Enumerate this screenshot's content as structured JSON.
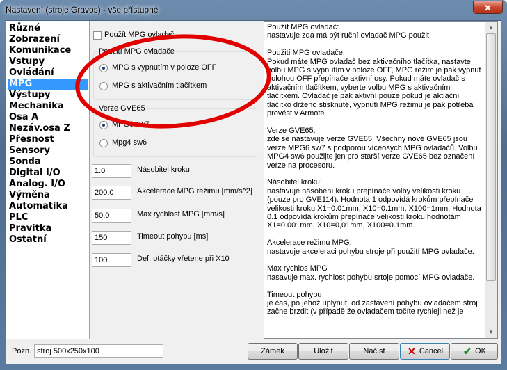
{
  "window": {
    "title": "Nastavení (stroje Gravos) - vše přístupné",
    "close_glyph": "✕"
  },
  "categories": [
    {
      "label": "Různé"
    },
    {
      "label": "Zobrazení"
    },
    {
      "label": "Komunikace"
    },
    {
      "label": "Vstupy"
    },
    {
      "label": "Ovládání"
    },
    {
      "label": "MPG",
      "selected": true
    },
    {
      "label": "Výstupy"
    },
    {
      "label": "Mechanika"
    },
    {
      "label": "Osa A"
    },
    {
      "label": "Nezáv.osa Z"
    },
    {
      "label": "Přesnost"
    },
    {
      "label": "Sensory"
    },
    {
      "label": "Sonda"
    },
    {
      "label": "Digital I/O"
    },
    {
      "label": "Analog. I/O"
    },
    {
      "label": "Výměna"
    },
    {
      "label": "Automatika"
    },
    {
      "label": "PLC"
    },
    {
      "label": "Pravitka"
    },
    {
      "label": "Ostatní"
    }
  ],
  "mpg": {
    "use_checkbox_label": "Použít MPG ovladač",
    "use_checked": false,
    "group_controller": {
      "title": "Použití MPG ovladače",
      "options": [
        "MPG s vypnutím v poloze OFF",
        "MPG s aktivačním tlačítkem"
      ],
      "selected": 0
    },
    "group_version": {
      "title": "Verze GVE65",
      "options": [
        "MPG6 sw7",
        "Mpg4 sw6"
      ],
      "selected": 0
    },
    "fields": [
      {
        "value": "1.0",
        "label": "Násobitel kroku"
      },
      {
        "value": "200.0",
        "label": "Akcelerace MPG režimu [mm/s^2]"
      },
      {
        "value": "50.0",
        "label": "Max rychlost MPG [mm/s]"
      },
      {
        "value": "150",
        "label": "Timeout pohybu [ms]"
      },
      {
        "value": "100",
        "label": "Def. otáčky vřetene při X10"
      }
    ]
  },
  "help_text": "Použít MPG ovladač:\nnastavuje zda má být ruční ovladač MPG použit.\n\nPoužití MPG ovladače:\nPokud máte MPG ovladač bez aktivačního tlačítka, nastavte volbu MPG s vypnutím v poloze OFF, MPG režim je pak vypnut polohou OFF přepínače aktivní osy. Pokud máte ovladač s aktivačním tlačítkem, vyberte volbu MPG s aktivačním tlačítkem. Ovladač je pak aktivní pouze pokud je aktiační tlačítko drženo stisknuté, vypnutí MPG režimu je pak potřeba provést v Armote.\n\nVerze GVE65:\nzde se nastavuje verze GVE65. Všechny nové GVE65 jsou verze MPG6 sw7 s podporou víceosých MPG ovladačů. Volbu MPG4 sw6 použijte jen pro starší verze GVE65 bez označení verze na procesoru.\n\nNásobitel kroku:\nnastavuje násobení kroku přepínače volby velikosti kroku (pouze pro GVE114). Hodnota 1 odpovídá krokům přepínače velikosti kroku X1=0.01mm, X10=0.1mm, X100=1mm. Hodnota 0.1 odpovídá krokům přepínače velikosti kroku hodnotám X1=0.001mm, X10=0,01mm, X100=0.1mm.\n\nAkcelerace režimu MPG:\nnastavuje akceleraci pohybu stroje při použití MPG ovladače.\n\nMax rychlos MPG\nnasavuje max. rychlost pohybu srtoje pomocí MPG ovladače.\n\nTimeout pohybu\nje čas, po jehož uplynutí od zastavení pohybu ovladačem stroj začne brzdit (v případě že ovladačem točíte rychleji než je",
  "bottom": {
    "note_label": "Pozn.",
    "note_value": "stroj 500x250x100",
    "lock_label": "Zámek",
    "save_label": "Uložit",
    "load_label": "Načíst",
    "cancel_label": "Cancel",
    "ok_label": "OK"
  },
  "colors": {
    "selection": "#3399ff",
    "annotation": "#e00000"
  }
}
